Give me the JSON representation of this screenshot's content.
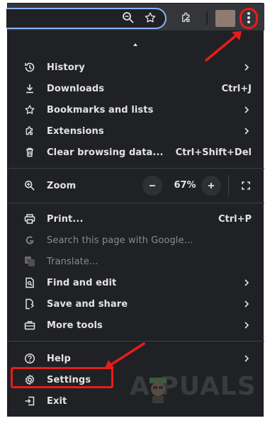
{
  "menu": {
    "items": [
      {
        "label": "History",
        "shortcut": "",
        "submenu": true,
        "enabled": true,
        "icon": "history-icon"
      },
      {
        "label": "Downloads",
        "shortcut": "Ctrl+J",
        "submenu": false,
        "enabled": true,
        "icon": "download-icon"
      },
      {
        "label": "Bookmarks and lists",
        "shortcut": "",
        "submenu": true,
        "enabled": true,
        "icon": "star-icon"
      },
      {
        "label": "Extensions",
        "shortcut": "",
        "submenu": true,
        "enabled": true,
        "icon": "puzzle-icon"
      },
      {
        "label": "Clear browsing data...",
        "shortcut": "Ctrl+Shift+Del",
        "submenu": false,
        "enabled": true,
        "icon": "trash-icon"
      }
    ],
    "zoom": {
      "label": "Zoom",
      "value": "67%"
    },
    "items2": [
      {
        "label": "Print...",
        "shortcut": "Ctrl+P",
        "enabled": true,
        "icon": "print-icon"
      },
      {
        "label": "Search this page with Google...",
        "shortcut": "",
        "enabled": false,
        "icon": "google-icon"
      },
      {
        "label": "Translate...",
        "shortcut": "",
        "enabled": false,
        "icon": "translate-icon"
      },
      {
        "label": "Find and edit",
        "shortcut": "",
        "submenu": true,
        "enabled": true,
        "icon": "find-icon"
      },
      {
        "label": "Save and share",
        "shortcut": "",
        "submenu": true,
        "enabled": true,
        "icon": "save-share-icon"
      },
      {
        "label": "More tools",
        "shortcut": "",
        "submenu": true,
        "enabled": true,
        "icon": "toolbox-icon"
      }
    ],
    "items3": [
      {
        "label": "Help",
        "submenu": true,
        "icon": "help-icon"
      },
      {
        "label": "Settings",
        "submenu": false,
        "icon": "gear-icon"
      },
      {
        "label": "Exit",
        "submenu": false,
        "icon": "exit-icon"
      }
    ]
  },
  "watermark": "A  PUALS",
  "colors": {
    "menu_bg": "#202124",
    "text": "#e3e3e3",
    "highlight": "#e81c1c",
    "omnibox_border": "#8ab4f8"
  }
}
